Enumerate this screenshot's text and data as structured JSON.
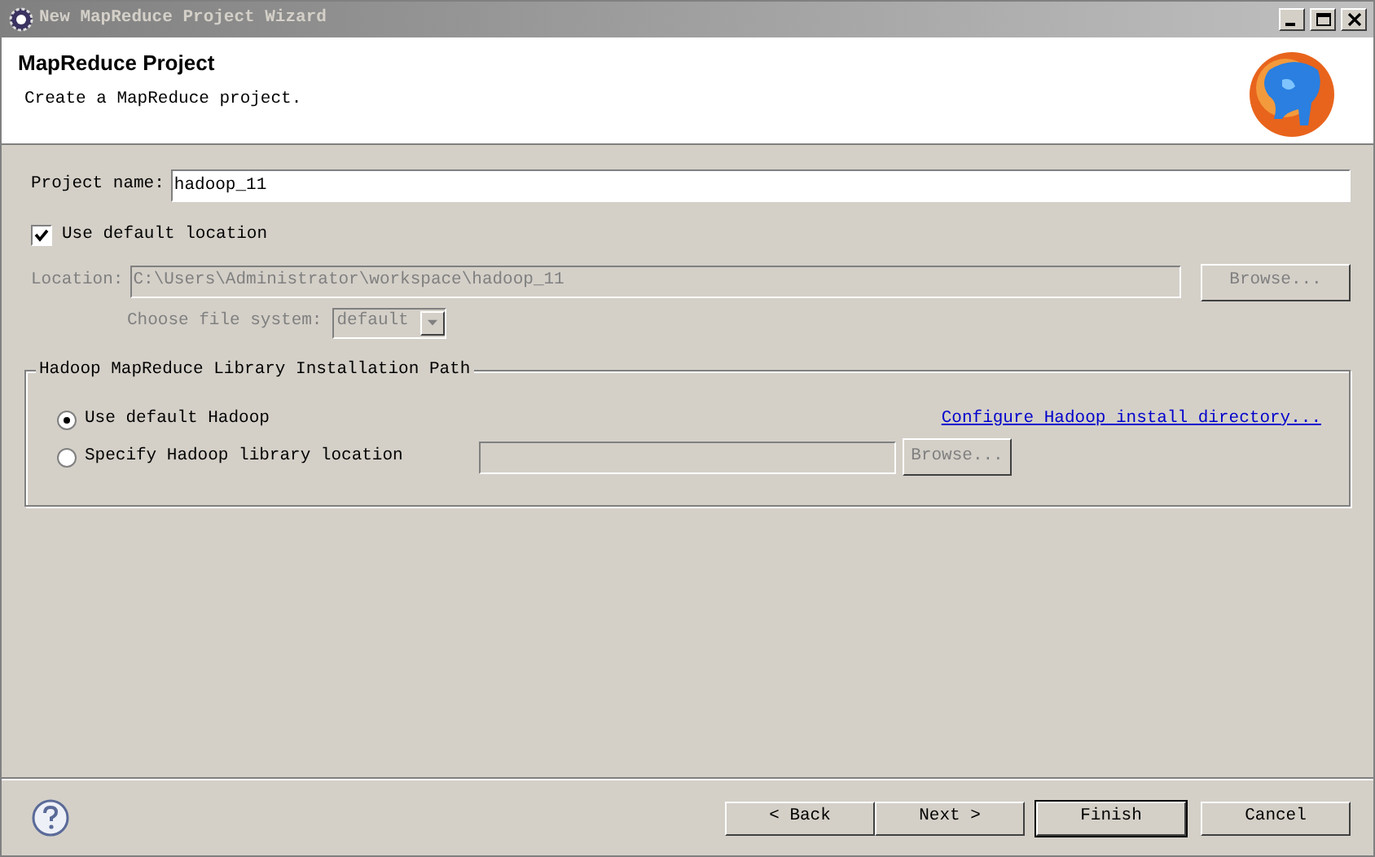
{
  "window": {
    "title": "New MapReduce Project Wizard"
  },
  "header": {
    "title": "MapReduce Project",
    "description": "Create a MapReduce project."
  },
  "project_name": {
    "label": "Project name:",
    "value": "hadoop_11"
  },
  "use_default_location": {
    "label": "Use default location",
    "checked": true
  },
  "location": {
    "label": "Location:",
    "value": "C:\\Users\\Administrator\\workspace\\hadoop_11",
    "disabled": true
  },
  "location_browse": {
    "label": "Browse...",
    "disabled": true
  },
  "file_system": {
    "label": "Choose file system:",
    "value": "default",
    "disabled": true
  },
  "library_group": {
    "title": "Hadoop MapReduce Library Installation Path",
    "options": [
      {
        "label": "Use default Hadoop",
        "selected": true
      },
      {
        "label": "Specify Hadoop library location",
        "selected": false
      }
    ],
    "link": "Configure Hadoop install directory...",
    "path_field": {
      "disabled": true
    },
    "browse": {
      "label": "Browse...",
      "disabled": true
    }
  },
  "buttons": [
    {
      "label": "< Back",
      "default": false
    },
    {
      "label": "Next >",
      "default": false
    },
    {
      "label": "Finish",
      "default": true
    },
    {
      "label": "Cancel",
      "default": false
    }
  ]
}
